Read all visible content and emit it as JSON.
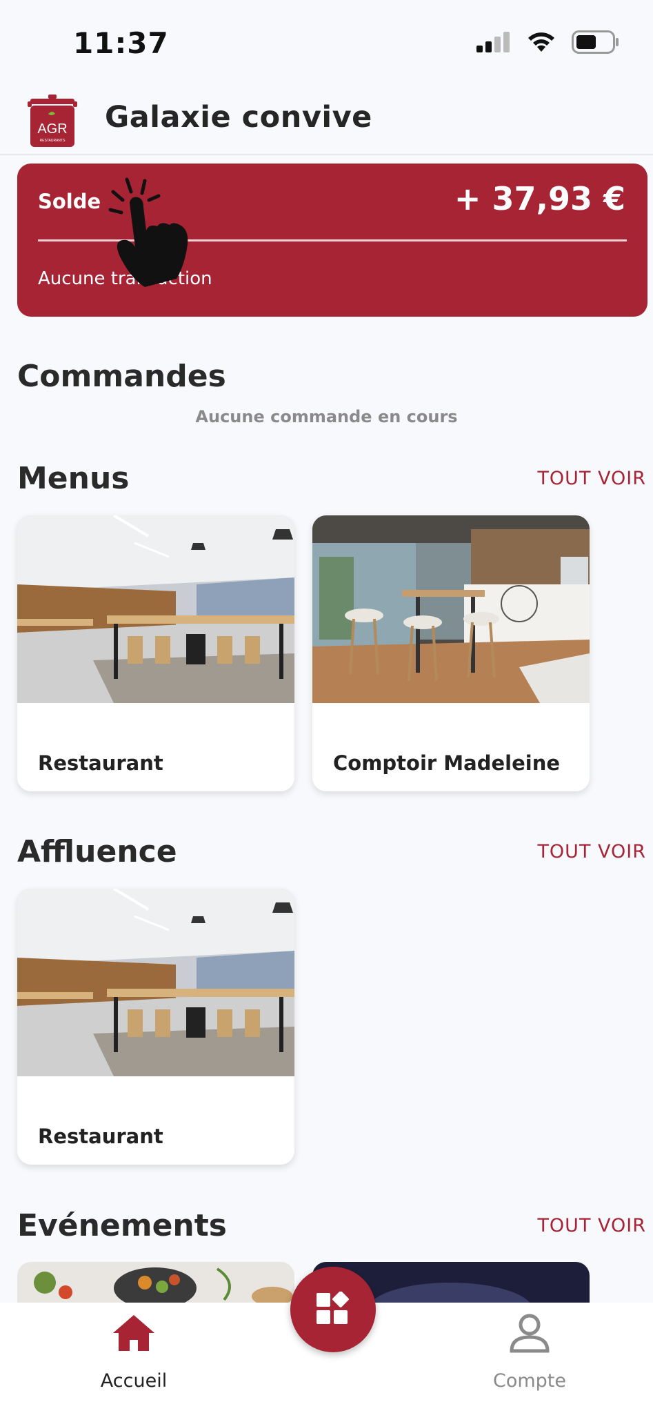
{
  "status_bar": {
    "time": "11:37",
    "icons": [
      "signal-icon",
      "wifi-icon",
      "battery-icon"
    ]
  },
  "header": {
    "logo_text": "AGR",
    "logo_subtext": "RESTAURANTS",
    "title": "Galaxie convive"
  },
  "balance": {
    "label": "Solde",
    "amount": "+ 37,93 €",
    "status": "Aucune transaction"
  },
  "orders": {
    "title": "Commandes",
    "empty_message": "Aucune commande en cours"
  },
  "menus": {
    "title": "Menus",
    "see_all": "TOUT VOIR",
    "items": [
      {
        "label": "Restaurant"
      },
      {
        "label": "Comptoir Madeleine"
      }
    ]
  },
  "affluence": {
    "title": "Affluence",
    "see_all": "TOUT VOIR",
    "items": [
      {
        "label": "Restaurant"
      }
    ]
  },
  "events": {
    "title": "Evénements",
    "see_all": "TOUT VOIR"
  },
  "tabs": [
    {
      "label": "Accueil",
      "icon": "home-icon",
      "active": true
    },
    {
      "label": "Compte",
      "icon": "user-icon",
      "active": false
    }
  ],
  "fab": {
    "icon": "widgets-icon"
  },
  "colors": {
    "accent": "#a62434",
    "background": "#f8f9fc",
    "inactive": "#8a8a8a"
  }
}
